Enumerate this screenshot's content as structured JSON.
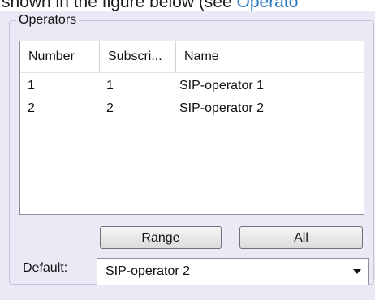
{
  "top_text": {
    "prefix": "shown in the figure below (see ",
    "link": "Operato"
  },
  "group": {
    "label": "Operators"
  },
  "table": {
    "columns": [
      "Number",
      "Subscri...",
      "Name"
    ],
    "rows": [
      [
        "1",
        "1",
        "SIP-operator 1"
      ],
      [
        "2",
        "2",
        "SIP-operator 2"
      ]
    ]
  },
  "buttons": {
    "range": "Range",
    "all": "All"
  },
  "default": {
    "label": "Default:",
    "value": "SIP-operator 2",
    "arrow_icon": "chevron-down-icon"
  }
}
